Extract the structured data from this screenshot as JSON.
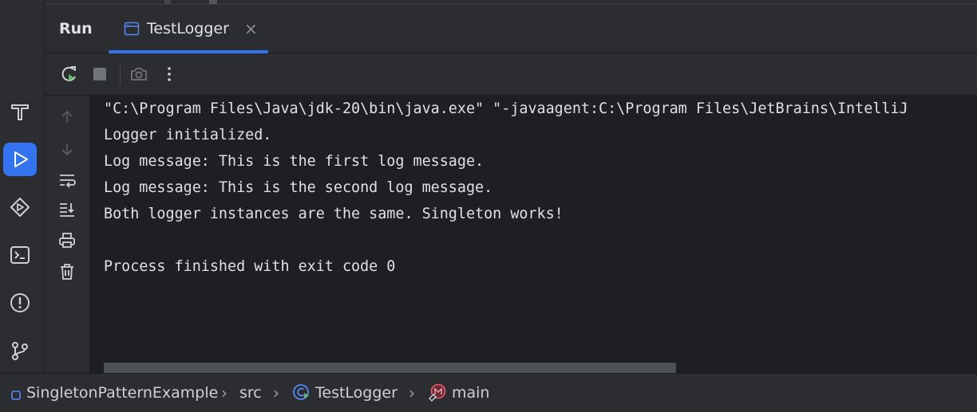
{
  "header": {
    "run_title": "Run",
    "tab": {
      "label": "TestLogger",
      "close": "×"
    }
  },
  "strip": {
    "items": [
      {
        "name": "build-hammer-icon"
      },
      {
        "name": "run-icon",
        "active": true
      },
      {
        "name": "services-icon"
      },
      {
        "name": "terminal-icon"
      },
      {
        "name": "problems-icon"
      },
      {
        "name": "git-icon"
      }
    ]
  },
  "toolbar": {
    "icons": [
      "rerun-icon",
      "stop-icon",
      "camera-icon",
      "more-vertical-icon"
    ]
  },
  "gutter": {
    "icons": [
      "up-arrow-icon",
      "down-arrow-icon",
      "soft-wrap-icon",
      "scroll-to-end-icon",
      "print-icon",
      "trash-icon"
    ]
  },
  "console": {
    "lines": [
      "\"C:\\Program Files\\Java\\jdk-20\\bin\\java.exe\" \"-javaagent:C:\\Program Files\\JetBrains\\IntelliJ",
      "Logger initialized.",
      "Log message: This is the first log message.",
      "Log message: This is the second log message.",
      "Both logger instances are the same. Singleton works!",
      "",
      "Process finished with exit code 0"
    ]
  },
  "breadcrumbs": {
    "project": "SingletonPatternExample",
    "folder": "src",
    "class": "TestLogger",
    "method": "main",
    "separator": "›"
  },
  "colors": {
    "accent": "#3574f0",
    "panel": "#2b2d30",
    "editor": "#1e1f22",
    "text": "#dfe1e5"
  }
}
